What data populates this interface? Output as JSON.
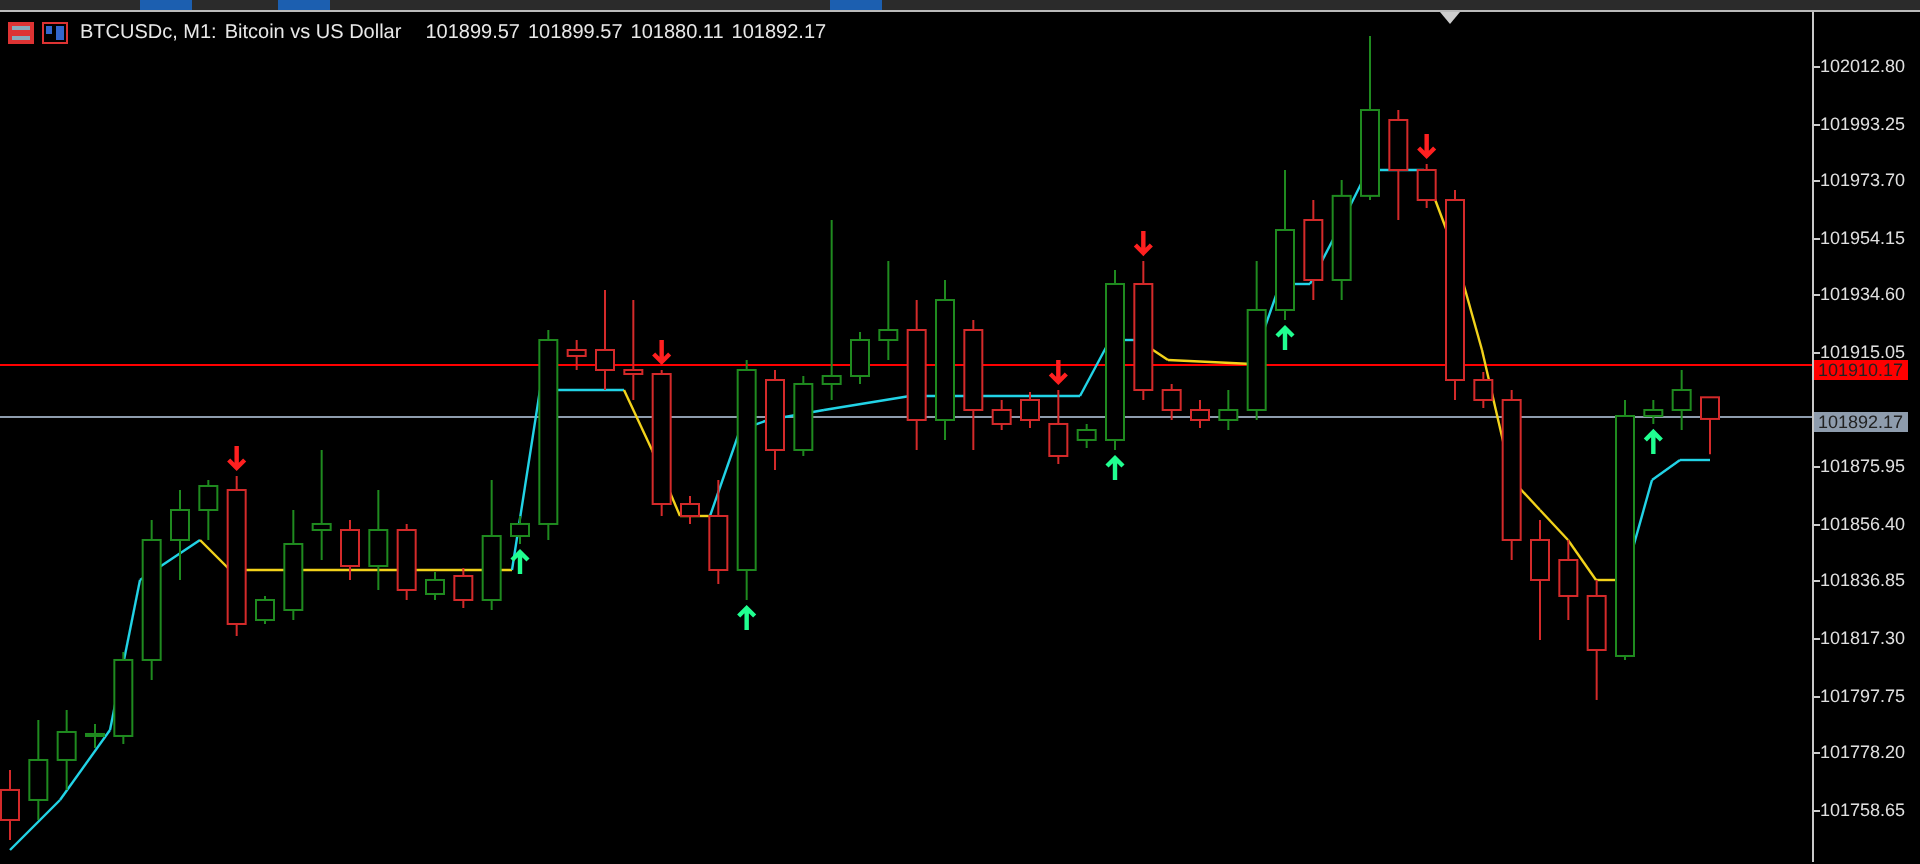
{
  "chart": {
    "symbol": "BTCUSDc, M1:",
    "description": "Bitcoin vs US Dollar",
    "ohlc": [
      "101899.57",
      "101899.57",
      "101880.11",
      "101892.17"
    ],
    "chart_data": {
      "type": "candlestick",
      "ohlc": [
        [
          101765.36,
          101772.19,
          101748.27,
          101755.1
        ],
        [
          101761.94,
          101789.28,
          101755.1,
          101775.61
        ],
        [
          101775.61,
          101792.7,
          101765.36,
          101785.18
        ],
        [
          101783.81,
          101787.91,
          101779.71,
          101784.5
        ],
        [
          101783.81,
          101812.52,
          101781.08,
          101809.79
        ],
        [
          101809.79,
          101857.63,
          101802.95,
          101850.8
        ],
        [
          101850.8,
          101867.88,
          101837.13,
          101861.05
        ],
        [
          101861.05,
          101871.3,
          101850.8,
          101869.25
        ],
        [
          101867.88,
          101872.67,
          101817.99,
          101822.09
        ],
        [
          101823.45,
          101831.66,
          101822.09,
          101830.29
        ],
        [
          101826.87,
          101861.05,
          101823.45,
          101849.43
        ],
        [
          101854.21,
          101881.56,
          101843.96,
          101856.27
        ],
        [
          101854.21,
          101857.63,
          101837.13,
          101841.91
        ],
        [
          101841.91,
          101867.88,
          101833.71,
          101854.21
        ],
        [
          101854.21,
          101856.27,
          101830.29,
          101833.71
        ],
        [
          101832.34,
          101839.86,
          101830.29,
          101837.13
        ],
        [
          101838.49,
          101841.23,
          101827.56,
          101830.29
        ],
        [
          101830.29,
          101871.3,
          101826.87,
          101852.16
        ],
        [
          101852.16,
          101859.0,
          101849.43,
          101856.27
        ],
        [
          101856.27,
          101922.57,
          101850.8,
          101919.15
        ],
        [
          101915.74,
          101919.15,
          101908.9,
          101913.69
        ],
        [
          101915.74,
          101936.24,
          101902.06,
          101908.9
        ],
        [
          101908.9,
          101932.82,
          101898.65,
          101907.53
        ],
        [
          101907.53,
          101908.9,
          101859.0,
          101863.1
        ],
        [
          101863.1,
          101865.83,
          101856.27,
          101859.0
        ],
        [
          101859.0,
          101871.3,
          101835.76,
          101840.54
        ],
        [
          101840.54,
          101912.32,
          101830.29,
          101908.9
        ],
        [
          101905.48,
          101908.9,
          101874.72,
          101881.56
        ],
        [
          101881.56,
          101906.85,
          101879.51,
          101904.12
        ],
        [
          101904.12,
          101960.17,
          101898.65,
          101906.85
        ],
        [
          101906.85,
          101921.89,
          101904.12,
          101919.15
        ],
        [
          101919.15,
          101946.15,
          101912.32,
          101922.57
        ],
        [
          101922.57,
          101932.82,
          101881.56,
          101891.81
        ],
        [
          101891.81,
          101939.66,
          101884.98,
          101932.82
        ],
        [
          101922.57,
          101925.99,
          101881.56,
          101895.23
        ],
        [
          101895.23,
          101898.65,
          101888.39,
          101890.45
        ],
        [
          101898.65,
          101901.38,
          101889.08,
          101891.81
        ],
        [
          101890.45,
          101902.06,
          101876.77,
          101879.51
        ],
        [
          101884.98,
          101890.45,
          101882.24,
          101888.39
        ],
        [
          101884.98,
          101943.08,
          101881.56,
          101938.29
        ],
        [
          101938.29,
          101946.15,
          101898.65,
          101902.06
        ],
        [
          101902.06,
          101904.12,
          101891.81,
          101895.23
        ],
        [
          101895.23,
          101898.65,
          101889.08,
          101891.81
        ],
        [
          101891.81,
          101902.06,
          101888.39,
          101895.23
        ],
        [
          101895.23,
          101946.15,
          101891.81,
          101929.41
        ],
        [
          101929.41,
          101977.26,
          101925.99,
          101956.75
        ],
        [
          101960.17,
          101967.0,
          101932.82,
          101939.66
        ],
        [
          101939.66,
          101973.84,
          101932.82,
          101968.41
        ],
        [
          101968.41,
          102023.06,
          101967.0,
          101997.76
        ],
        [
          101994.35,
          101997.76,
          101960.17,
          101977.26
        ],
        [
          101977.26,
          101979.31,
          101964.27,
          101967.0
        ],
        [
          101967.0,
          101970.42,
          101898.65,
          101905.48
        ],
        [
          101905.48,
          101908.22,
          101895.92,
          101898.65
        ],
        [
          101898.65,
          101902.06,
          101843.96,
          101850.8
        ],
        [
          101850.8,
          101857.63,
          101816.62,
          101837.13
        ],
        [
          101843.96,
          101850.8,
          101823.45,
          101831.66
        ],
        [
          101831.66,
          101837.13,
          101796.12,
          101813.2
        ],
        [
          101811.15,
          101898.65,
          101809.79,
          101893.18
        ],
        [
          101893.18,
          101898.65,
          101890.45,
          101895.23
        ],
        [
          101895.23,
          101908.9,
          101888.39,
          101902.06
        ],
        [
          101899.57,
          101899.57,
          101880.11,
          101892.17
        ]
      ],
      "ylim": [
        101740.74,
        102031.26
      ],
      "yticks": [
        {
          "value": 102012.8,
          "label": "102012.80"
        },
        {
          "value": 101993.25,
          "label": "101993.25"
        },
        {
          "value": 101973.7,
          "label": "101973.70"
        },
        {
          "value": 101954.15,
          "label": "101954.15"
        },
        {
          "value": 101934.6,
          "label": "101934.60"
        },
        {
          "value": 101915.05,
          "label": "101915.05"
        },
        {
          "value": 101875.95,
          "label": "101875.95"
        },
        {
          "value": 101856.4,
          "label": "101856.40"
        },
        {
          "value": 101836.85,
          "label": "101836.85"
        },
        {
          "value": 101817.3,
          "label": "101817.30"
        },
        {
          "value": 101797.75,
          "label": "101797.75"
        },
        {
          "value": 101778.2,
          "label": "101778.20"
        },
        {
          "value": 101758.65,
          "label": "101758.65"
        }
      ]
    }
  },
  "price_axis": {
    "price_labels": [
      {
        "text": "101910.17",
        "color": "#ff0000"
      },
      {
        "text": "101892.17",
        "color": "#8e9cad"
      }
    ]
  }
}
